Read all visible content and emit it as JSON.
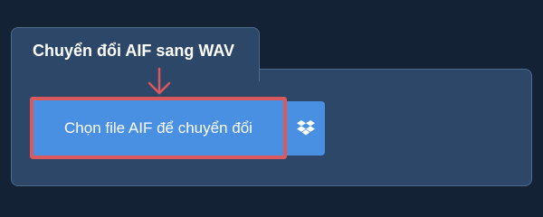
{
  "converter": {
    "title": "Chuyển đổi AIF sang WAV",
    "choose_file_label": "Chọn file AIF để chuyển đổi"
  },
  "icons": {
    "pointer": "arrow-down-icon",
    "cloud": "dropbox-icon"
  },
  "colors": {
    "background": "#142236",
    "panel": "#2c4767",
    "button": "#4a90e2",
    "highlight": "#d9595e"
  }
}
